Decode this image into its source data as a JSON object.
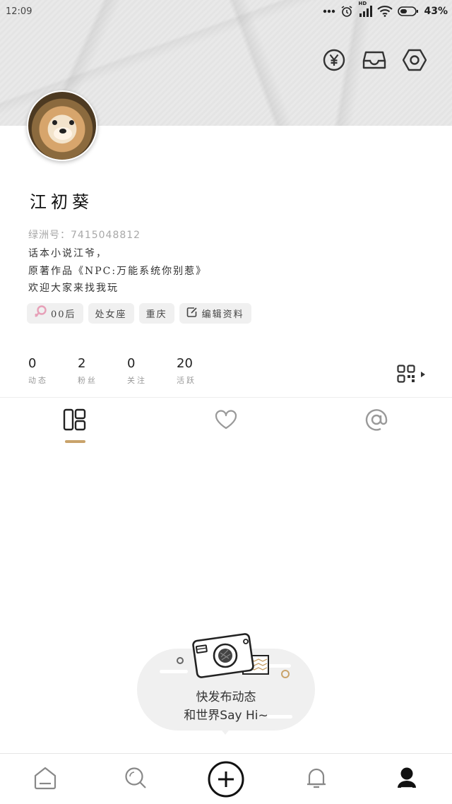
{
  "status_bar": {
    "time": "12:09",
    "network_badge": "HD",
    "battery": "43%"
  },
  "header": {
    "icons": [
      "yen-coin-icon",
      "inbox-tray-icon",
      "hexagon-settings-icon"
    ]
  },
  "profile": {
    "name": "江初葵",
    "id_text": "绿洲号：7415048812",
    "bio": [
      "话本小说江爷，",
      "原著作品《NPC:万能系统你别惹》",
      "欢迎大家来找我玩"
    ],
    "tags": {
      "age": "00后",
      "zodiac": "处女座",
      "city": "重庆",
      "edit": "编辑资料"
    }
  },
  "stats": [
    {
      "value": "0",
      "label": "动态"
    },
    {
      "value": "2",
      "label": "粉丝"
    },
    {
      "value": "0",
      "label": "关注"
    },
    {
      "value": "20",
      "label": "活跃"
    }
  ],
  "content_tabs": {
    "active_index": 0,
    "icons": [
      "grid-posts-icon",
      "heart-icon",
      "at-mention-icon"
    ]
  },
  "empty_state": {
    "line1": "快发布动态",
    "line2": "和世界Say Hi~"
  },
  "bottom_nav": {
    "icons": [
      "home-icon",
      "search-icon",
      "add-post-icon",
      "notification-bell-icon",
      "profile-icon"
    ]
  },
  "colors": {
    "accent": "#c9a36b",
    "tag_bg": "#f0f0f0",
    "muted_text": "#999999",
    "age_icon": "#e7a0b8"
  }
}
